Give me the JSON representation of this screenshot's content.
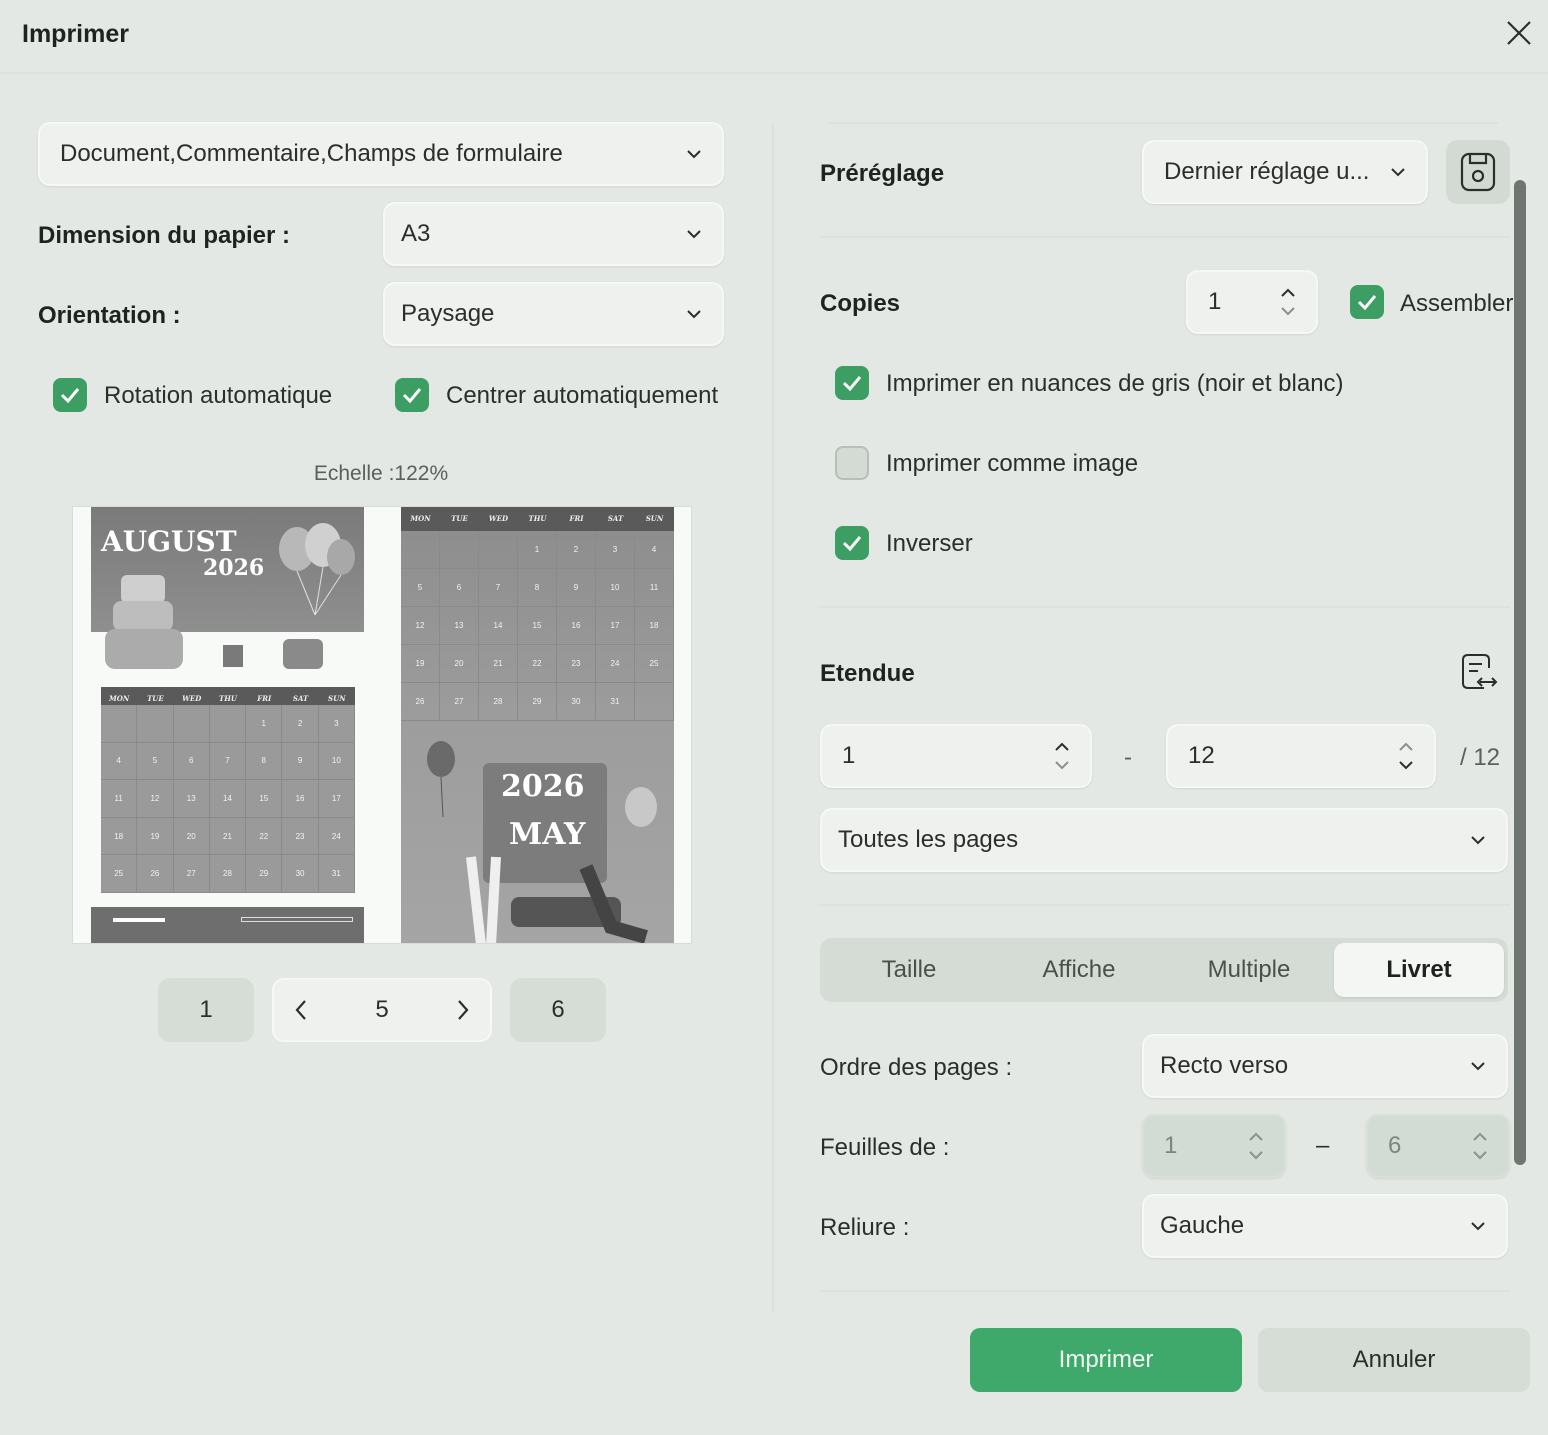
{
  "dialog": {
    "title": "Imprimer"
  },
  "left": {
    "content_select": "Document,Commentaire,Champs de formulaire",
    "paper_label": "Dimension du papier :",
    "paper_value": "A3",
    "orientation_label": "Orientation :",
    "orientation_value": "Paysage",
    "auto_rotate": {
      "label": "Rotation automatique",
      "checked": true
    },
    "auto_center": {
      "label": "Centrer automatiquement",
      "checked": true
    },
    "scale": "Echelle :122%",
    "preview": {
      "left_hero_month": "AUGUST",
      "left_hero_year": "2026",
      "right_title_year": "2026",
      "right_title_month": "MAY",
      "weekdays": [
        "MON",
        "TUE",
        "WED",
        "THU",
        "FRI",
        "SAT",
        "SUN"
      ],
      "left_days": [
        "",
        "",
        "",
        "",
        "1",
        "2",
        "3",
        "4",
        "5",
        "6",
        "7",
        "8",
        "9",
        "10",
        "11",
        "12",
        "13",
        "14",
        "15",
        "16",
        "17",
        "18",
        "19",
        "20",
        "21",
        "22",
        "23",
        "24",
        "25",
        "26",
        "27",
        "28",
        "29",
        "30",
        "31"
      ],
      "right_days": [
        "",
        "",
        "",
        "1",
        "2",
        "3",
        "4",
        "5",
        "6",
        "7",
        "8",
        "9",
        "10",
        "11",
        "12",
        "13",
        "14",
        "15",
        "16",
        "17",
        "18",
        "19",
        "20",
        "21",
        "22",
        "23",
        "24",
        "25",
        "26",
        "27",
        "28",
        "29",
        "30",
        "31",
        ""
      ]
    },
    "pagination": {
      "first": "1",
      "current": "5",
      "last": "6"
    }
  },
  "right": {
    "preset_label": "Préréglage",
    "preset_value": "Dernier réglage u...",
    "copies_label": "Copies",
    "copies_value": "1",
    "collate": {
      "label": "Assembler",
      "checked": true
    },
    "grayscale": {
      "label": "Imprimer en nuances de gris (noir et blanc)",
      "checked": true
    },
    "as_image": {
      "label": "Imprimer comme image",
      "checked": false
    },
    "reverse": {
      "label": "Inverser",
      "checked": true
    },
    "range_label": "Etendue",
    "range_from": "1",
    "range_sep": "-",
    "range_to": "12",
    "range_total": "/ 12",
    "pages_select": "Toutes les pages",
    "tabs": [
      "Taille",
      "Affiche",
      "Multiple",
      "Livret"
    ],
    "active_tab": "Livret",
    "page_order_label": "Ordre des pages :",
    "page_order_value": "Recto verso",
    "sheets_label": "Feuilles de :",
    "sheets_from": "1",
    "sheets_sep": "–",
    "sheets_to": "6",
    "binding_label": "Reliure :",
    "binding_value": "Gauche"
  },
  "footer": {
    "print": "Imprimer",
    "cancel": "Annuler"
  },
  "colors": {
    "accent": "#3fa86b",
    "background": "#e4e8e4"
  }
}
